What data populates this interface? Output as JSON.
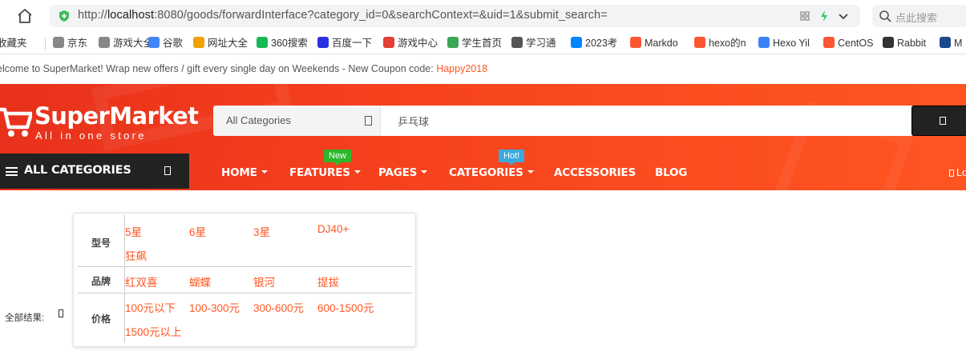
{
  "browser": {
    "url_scheme": "http://",
    "url_host": "localhost",
    "url_rest": ":8080/goods/forwardInterface?category_id=0&searchContext=&uid=1&submit_search=",
    "search_placeholder": "点此搜索"
  },
  "bookmarks": [
    {
      "label": "收藏夹",
      "icon": "star-icon",
      "color": "#f6b100"
    },
    {
      "label": "京东",
      "icon": "folder-icon",
      "color": "#888888"
    },
    {
      "label": "游戏大全",
      "icon": "folder-icon",
      "color": "#888888"
    },
    {
      "label": "谷歌",
      "icon": "google-icon",
      "color": "#4285f4"
    },
    {
      "label": "网址大全",
      "icon": "globe-icon",
      "color": "#f0a000"
    },
    {
      "label": "360搜索",
      "icon": "search-360-icon",
      "color": "#19b955"
    },
    {
      "label": "百度一下",
      "icon": "baidu-icon",
      "color": "#2932e1"
    },
    {
      "label": "游戏中心",
      "icon": "game-icon",
      "color": "#e33e33"
    },
    {
      "label": "学生首页",
      "icon": "chart-icon",
      "color": "#3aa757"
    },
    {
      "label": "学习通",
      "icon": "globe-icon",
      "color": "#555555"
    },
    {
      "label": "2023考",
      "icon": "zhihu-icon",
      "color": "#0084ff"
    },
    {
      "label": "Markdo",
      "icon": "csdn-icon",
      "color": "#fc5531"
    },
    {
      "label": "hexo的n",
      "icon": "csdn-icon",
      "color": "#fc5531"
    },
    {
      "label": "Hexo Yil",
      "icon": "hexo-icon",
      "color": "#3b82f6"
    },
    {
      "label": "CentOS",
      "icon": "csdn-icon",
      "color": "#fc5531"
    },
    {
      "label": "Rabbit",
      "icon": "rabbit-icon",
      "color": "#333333"
    },
    {
      "label": "M",
      "icon": "mvn-icon",
      "color": "#1a4a8a"
    }
  ],
  "topbar": {
    "welcome_text": "elcome to SuperMarket! Wrap new offers / gift every single day on Weekends - New Coupon code: ",
    "coupon_code": "Happy2018"
  },
  "header": {
    "logo_title": "SuperMarket",
    "logo_subtitle": "All in one store",
    "category_select": "All Categories",
    "search_value": "乒乓球",
    "all_categories_label": "ALL CATEGORIES",
    "nav": [
      {
        "label": "HOME",
        "dropdown": true
      },
      {
        "label": "FEATURES",
        "dropdown": true,
        "badge": "New"
      },
      {
        "label": "PAGES",
        "dropdown": true
      },
      {
        "label": "CATEGORIES",
        "dropdown": true,
        "badge": "Hot!"
      },
      {
        "label": "ACCESSORIES",
        "dropdown": false
      },
      {
        "label": "BLOG",
        "dropdown": false
      }
    ],
    "login_fragment": "Lo",
    "colors": {
      "accent": "#f43f1e",
      "dark": "#222222",
      "badge_new": "#2cb72c",
      "badge_hot": "#3aa9e0"
    }
  },
  "filters": {
    "result_label": "全部结果:",
    "rows": [
      {
        "key": "型号",
        "values": [
          "5星",
          "6星",
          "3星",
          "DJ40+",
          "狂飙"
        ]
      },
      {
        "key": "品牌",
        "values": [
          "红双喜",
          "蝴蝶",
          "银河",
          "提拔"
        ]
      },
      {
        "key": "价格",
        "values": [
          "100元以下",
          "100-300元",
          "300-600元",
          "600-1500元",
          "1500元以上"
        ]
      }
    ],
    "value_color": "#ff5722"
  }
}
